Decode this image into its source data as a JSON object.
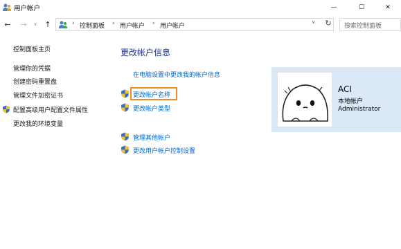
{
  "window": {
    "title": "用户帐户",
    "title_icon": "users-icon",
    "controls": {
      "minimize": "—",
      "maximize": "☐",
      "close": "✕"
    }
  },
  "nav": {
    "back": "←",
    "forward": "→",
    "recent": "∨",
    "up": "↑",
    "breadcrumb": [
      "控制面板",
      "用户帐户",
      "用户帐户"
    ],
    "separator": "›",
    "dropdown": "∨",
    "refresh": "↻",
    "search_placeholder": "搜索控制面板"
  },
  "sidebar": {
    "items": [
      {
        "label": "控制面板主页",
        "shield": false
      },
      {
        "label": "管理你的凭据",
        "shield": false
      },
      {
        "label": "创建密码重置盘",
        "shield": false
      },
      {
        "label": "管理文件加密证书",
        "shield": false
      },
      {
        "label": "配置高级用户配置文件属性",
        "shield": true
      },
      {
        "label": "更改我的环境变量",
        "shield": false
      }
    ]
  },
  "main": {
    "title": "更改帐户信息",
    "links": [
      {
        "label": "在电脑设置中更改我的帐户信息",
        "shield": false
      },
      {
        "label": "更改帐户名称",
        "shield": true,
        "highlighted": true
      },
      {
        "label": "更改帐户类型",
        "shield": true
      },
      {
        "label": "管理其他帐户",
        "shield": true
      },
      {
        "label": "更改用户帐户控制设置",
        "shield": true
      }
    ]
  },
  "account": {
    "name": "ACI",
    "type": "本地帐户",
    "role": "Administrator",
    "card_color": "#dbe9f7"
  },
  "colors": {
    "link": "#0066cc",
    "title": "#1e3287",
    "highlight": "#f08a24"
  }
}
